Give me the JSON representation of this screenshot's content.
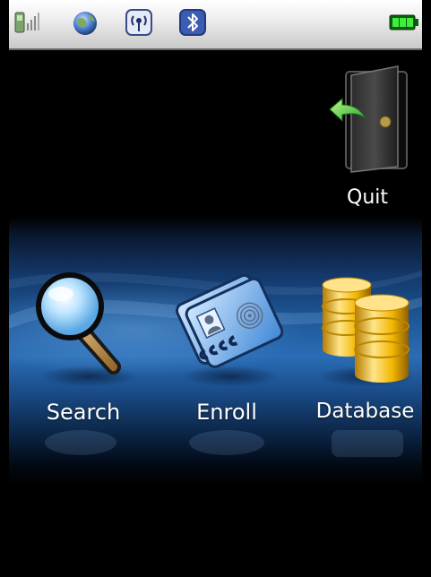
{
  "status_bar": {
    "icons": [
      "signal-icon",
      "globe-icon",
      "wireless-icon",
      "bluetooth-icon",
      "battery-icon"
    ]
  },
  "menu": {
    "quit": {
      "label": "Quit",
      "icon": "door-exit-icon"
    },
    "search": {
      "label": "Search",
      "icon": "magnifier-icon"
    },
    "enroll": {
      "label": "Enroll",
      "icon": "fingerprint-card-icon"
    },
    "database": {
      "label": "Database",
      "icon": "database-icon"
    }
  },
  "colors": {
    "background": "#000000",
    "band_blue": "#2a6db5",
    "battery_green": "#19c419"
  }
}
